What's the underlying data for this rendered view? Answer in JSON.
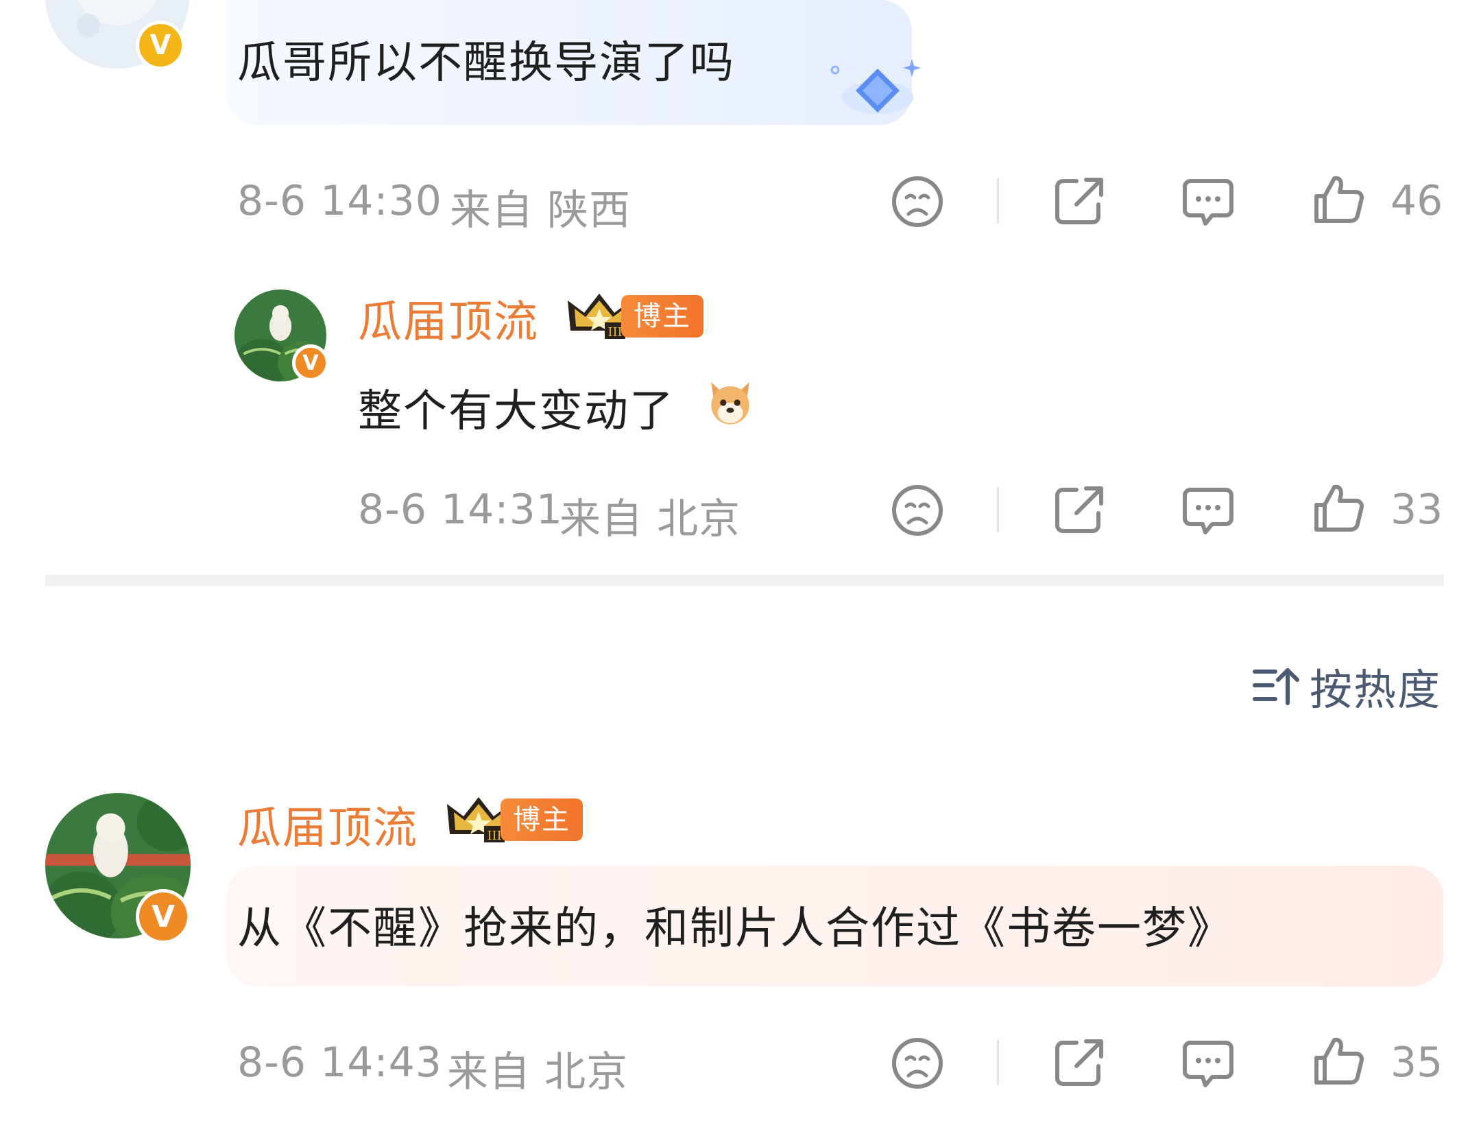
{
  "comments": [
    {
      "text": "瓜哥所以不醒换导演了吗",
      "time": "8-6 14:30",
      "location": "来自 陕西",
      "likes": "46"
    },
    {
      "author": "瓜届顶流",
      "badge": "博主",
      "text": "整个有大变动了",
      "time": "8-6 14:31",
      "location": "来自 北京",
      "likes": "33"
    },
    {
      "author": "瓜届顶流",
      "badge": "博主",
      "text": "从《不醒》抢来的，和制片人合作过《书卷一梦》",
      "time": "8-6 14:43",
      "location": "来自 北京",
      "likes": "35"
    }
  ],
  "sort": {
    "label": "按热度"
  },
  "colors": {
    "author": "#eb7c35",
    "meta": "#9a9a9a",
    "verified": "#f2b417",
    "badge": "#f0732a"
  }
}
